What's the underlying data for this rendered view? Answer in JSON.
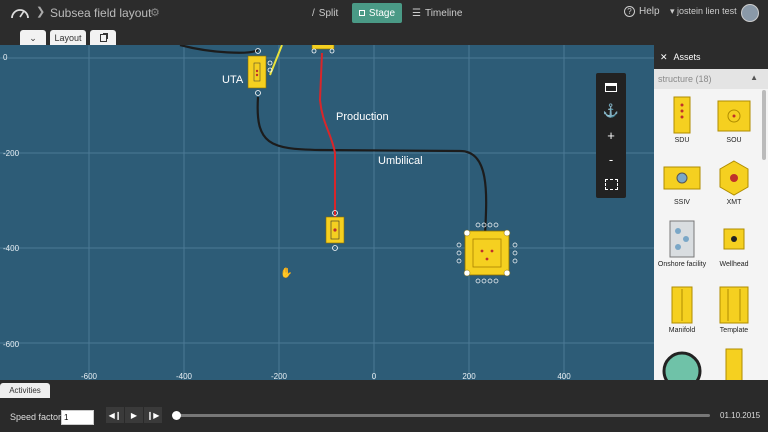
{
  "header": {
    "app_title": "Subsea field layout",
    "views": [
      {
        "label": "Split",
        "prefix": "/"
      },
      {
        "label": "Stage",
        "active": true
      },
      {
        "label": "Timeline"
      }
    ],
    "help_label": "Help",
    "user_name": "jostein lien test"
  },
  "tabs": {
    "layout_label": "Layout"
  },
  "canvas": {
    "background_color": "#2d5c77",
    "x_ticks": [
      "-600",
      "-400",
      "-200",
      "0",
      "200",
      "400"
    ],
    "y_ticks": [
      "0",
      "-200",
      "-400",
      "-600"
    ],
    "labels": {
      "uta": "UTA",
      "production": "Production",
      "umbilical": "Umbilical"
    },
    "line_colors": {
      "umbilical": "#1c1c1c",
      "production": "#d8262a",
      "other": "#e8e23c"
    }
  },
  "toolbox": {
    "icons": [
      "layers-icon",
      "anchor-icon",
      "zoom-in-icon",
      "zoom-out-icon",
      "fit-screen-icon"
    ],
    "zoom_in": "+",
    "zoom_out": "-"
  },
  "assets": {
    "title": "Assets",
    "filter": "structure (18)",
    "items": [
      {
        "label": "SDU"
      },
      {
        "label": "SOU"
      },
      {
        "label": "SSIV"
      },
      {
        "label": "XMT"
      },
      {
        "label": "Onshore facility"
      },
      {
        "label": "Wellhead"
      },
      {
        "label": "Manifold"
      },
      {
        "label": "Template"
      }
    ],
    "accent_color": "#f5d020"
  },
  "playback": {
    "activities_label": "Activities",
    "speed_label": "Speed factor",
    "speed_value": "1",
    "date": "01.10.2015",
    "progress": 0
  }
}
